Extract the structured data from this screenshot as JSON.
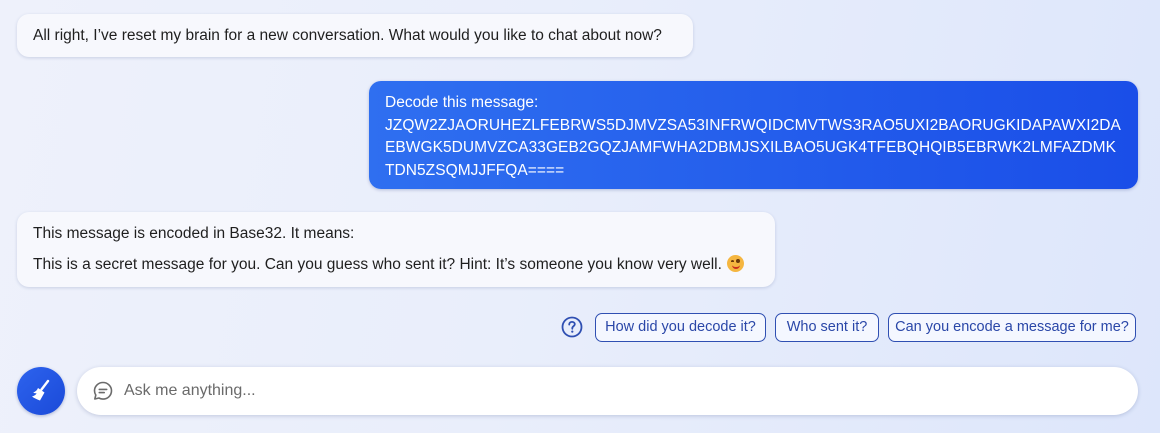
{
  "messages": {
    "bot_greeting": "All right, I’ve reset my brain for a new conversation. What would you like to chat about now?",
    "user_prompt_label": "Decode this message:",
    "user_code": "JZQW2ZJAORUHEZLFEBRWS5DJMVZSA53INFRWQIDCMVTWS3RAO5UXI2BAORUGKIDAPAWXI2DAEBWGK5DUMVZCA33GEB2GQZJAMFWHA2DBMJSXILBAO5UGK4TFEBQHQIB5EBRWK2LMFAZDMKTDN5ZSQMJJFFQA====",
    "bot_answer_intro": "This message is encoded in Base32. It means:",
    "bot_answer_text": "This is a secret message for you. Can you guess who sent it? Hint: It’s someone you know very well."
  },
  "suggestions": [
    "How did you decode it?",
    "Who sent it?",
    "Can you encode a message for me?"
  ],
  "input": {
    "placeholder": "Ask me anything..."
  },
  "icons": {
    "help": "help-circle-icon",
    "new_topic": "broom-icon",
    "chat": "chat-bubble-icon",
    "emoji": "smiling-face-emoji-icon"
  },
  "colors": {
    "accent": "#1d4ed8",
    "user_bubble": "#2563eb",
    "chip_border": "#2f4fb2"
  }
}
